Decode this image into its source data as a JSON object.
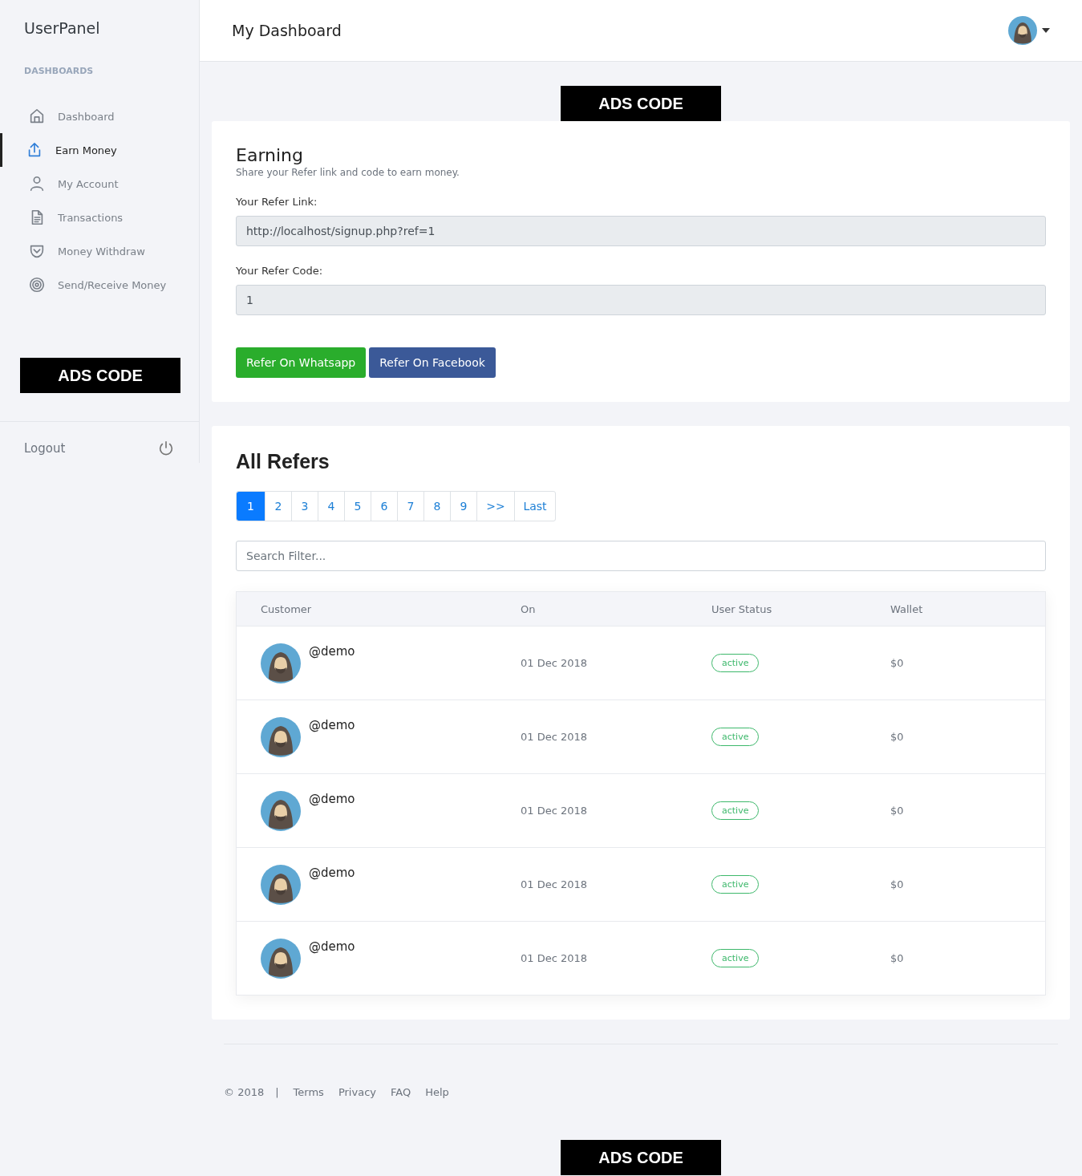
{
  "sidebar": {
    "brand": "UserPanel",
    "section_label": "DASHBOARDS",
    "items": [
      {
        "label": "Dashboard",
        "selected": false
      },
      {
        "label": "Earn Money",
        "selected": true
      },
      {
        "label": "My Account",
        "selected": false
      },
      {
        "label": "Transactions",
        "selected": false
      },
      {
        "label": "Money Withdraw",
        "selected": false
      },
      {
        "label": "Send/Receive Money",
        "selected": false
      }
    ],
    "ad": "ADS CODE",
    "logout": "Logout"
  },
  "header": {
    "title": "My Dashboard"
  },
  "top_ad": "ADS CODE",
  "earning": {
    "title": "Earning",
    "subtitle": "Share your Refer link and code to earn money.",
    "fields": [
      {
        "label": "Your Refer Link:",
        "value": "http://localhost/signup.php?ref=1"
      },
      {
        "label": "Your Refer Code:",
        "value": "1"
      }
    ],
    "buttons": [
      {
        "label": "Refer On Whatsapp",
        "kind": "whatsapp"
      },
      {
        "label": "Refer On Facebook",
        "kind": "facebook"
      }
    ]
  },
  "refers": {
    "title": "All Refers",
    "pagination": [
      {
        "label": "1",
        "selected": true
      },
      {
        "label": "2",
        "selected": false
      },
      {
        "label": "3",
        "selected": false
      },
      {
        "label": "4",
        "selected": false
      },
      {
        "label": "5",
        "selected": false
      },
      {
        "label": "6",
        "selected": false
      },
      {
        "label": "7",
        "selected": false
      },
      {
        "label": "8",
        "selected": false
      },
      {
        "label": "9",
        "selected": false
      },
      {
        "label": ">>",
        "selected": false
      },
      {
        "label": "Last",
        "selected": false
      }
    ],
    "search": {
      "placeholder": "Search Filter..."
    },
    "table": {
      "columns": [
        "Customer",
        "On",
        "User Status",
        "Wallet"
      ],
      "rows": [
        {
          "customer": "@demo",
          "on": "01 Dec 2018",
          "status": "active",
          "wallet": "$0"
        },
        {
          "customer": "@demo",
          "on": "01 Dec 2018",
          "status": "active",
          "wallet": "$0"
        },
        {
          "customer": "@demo",
          "on": "01 Dec 2018",
          "status": "active",
          "wallet": "$0"
        },
        {
          "customer": "@demo",
          "on": "01 Dec 2018",
          "status": "active",
          "wallet": "$0"
        },
        {
          "customer": "@demo",
          "on": "01 Dec 2018",
          "status": "active",
          "wallet": "$0"
        }
      ]
    }
  },
  "footer": {
    "copyright": "© 2018",
    "separator": "|",
    "links": [
      "Terms",
      "Privacy",
      "FAQ",
      "Help"
    ]
  },
  "bottom_ad": "ADS CODE"
}
